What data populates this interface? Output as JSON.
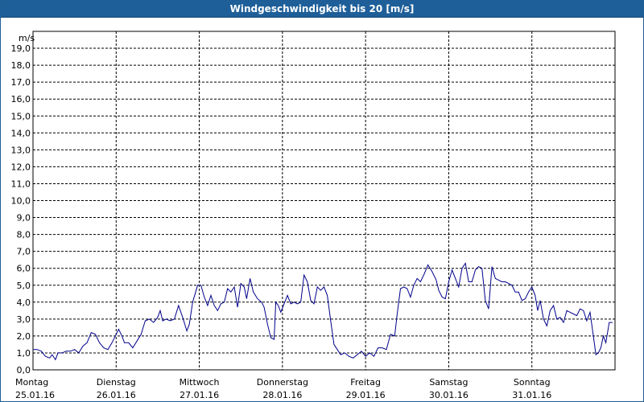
{
  "window": {
    "title": "Windgeschwindigkeit bis 20 [m/s]"
  },
  "chart_data": {
    "type": "line",
    "title": "Windgeschwindigkeit bis 20 [m/s]",
    "ylabel": "m/s",
    "xlabel": "",
    "ylim": [
      0,
      20
    ],
    "xlim": [
      0,
      7
    ],
    "y_ticks": [
      "0,0",
      "1,0",
      "2,0",
      "3,0",
      "4,0",
      "5,0",
      "6,0",
      "7,0",
      "8,0",
      "9,0",
      "10,0",
      "11,0",
      "12,0",
      "13,0",
      "14,0",
      "15,0",
      "16,0",
      "17,0",
      "18,0",
      "19,0"
    ],
    "x_ticks": [
      {
        "day": "Montag",
        "date": "25.01.16"
      },
      {
        "day": "Dienstag",
        "date": "26.01.16"
      },
      {
        "day": "Mittwoch",
        "date": "27.01.16"
      },
      {
        "day": "Donnerstag",
        "date": "28.01.16"
      },
      {
        "day": "Freitag",
        "date": "29.01.16"
      },
      {
        "day": "Samstag",
        "date": "30.01.16"
      },
      {
        "day": "Sonntag",
        "date": "31.01.16"
      }
    ],
    "grid": true,
    "line_color": "#00008b",
    "series": [
      {
        "values": [
          [
            0.0,
            1.2
          ],
          [
            0.05,
            1.2
          ],
          [
            0.1,
            1.1
          ],
          [
            0.15,
            0.8
          ],
          [
            0.2,
            0.7
          ],
          [
            0.23,
            0.9
          ],
          [
            0.27,
            0.6
          ],
          [
            0.3,
            1.0
          ],
          [
            0.35,
            1.0
          ],
          [
            0.4,
            1.1
          ],
          [
            0.45,
            1.1
          ],
          [
            0.5,
            1.2
          ],
          [
            0.55,
            1.0
          ],
          [
            0.6,
            1.4
          ],
          [
            0.65,
            1.6
          ],
          [
            0.7,
            2.2
          ],
          [
            0.75,
            2.1
          ],
          [
            0.8,
            1.6
          ],
          [
            0.85,
            1.3
          ],
          [
            0.9,
            1.2
          ],
          [
            0.95,
            1.6
          ],
          [
            1.0,
            2.1
          ],
          [
            1.03,
            2.4
          ],
          [
            1.07,
            2.0
          ],
          [
            1.1,
            1.6
          ],
          [
            1.15,
            1.6
          ],
          [
            1.2,
            1.3
          ],
          [
            1.25,
            1.7
          ],
          [
            1.3,
            2.1
          ],
          [
            1.35,
            2.9
          ],
          [
            1.4,
            3.0
          ],
          [
            1.45,
            2.8
          ],
          [
            1.5,
            3.1
          ],
          [
            1.53,
            3.5
          ],
          [
            1.56,
            2.9
          ],
          [
            1.6,
            3.0
          ],
          [
            1.65,
            2.9
          ],
          [
            1.7,
            3.0
          ],
          [
            1.75,
            3.8
          ],
          [
            1.8,
            3.1
          ],
          [
            1.85,
            2.3
          ],
          [
            1.88,
            2.7
          ],
          [
            1.92,
            4.0
          ],
          [
            1.95,
            4.5
          ],
          [
            1.98,
            5.0
          ],
          [
            2.02,
            5.0
          ],
          [
            2.06,
            4.3
          ],
          [
            2.1,
            3.8
          ],
          [
            2.14,
            4.4
          ],
          [
            2.18,
            3.8
          ],
          [
            2.22,
            3.5
          ],
          [
            2.26,
            3.9
          ],
          [
            2.3,
            4.0
          ],
          [
            2.34,
            4.8
          ],
          [
            2.38,
            4.6
          ],
          [
            2.42,
            4.9
          ],
          [
            2.46,
            3.7
          ],
          [
            2.5,
            5.1
          ],
          [
            2.54,
            4.9
          ],
          [
            2.57,
            4.2
          ],
          [
            2.61,
            5.4
          ],
          [
            2.65,
            4.6
          ],
          [
            2.7,
            4.2
          ],
          [
            2.75,
            4.0
          ],
          [
            2.78,
            3.7
          ],
          [
            2.82,
            2.7
          ],
          [
            2.86,
            1.9
          ],
          [
            2.9,
            1.8
          ],
          [
            2.92,
            4.0
          ],
          [
            2.95,
            3.8
          ],
          [
            2.98,
            3.4
          ],
          [
            3.02,
            3.9
          ],
          [
            3.06,
            4.4
          ],
          [
            3.1,
            3.9
          ],
          [
            3.14,
            4.0
          ],
          [
            3.18,
            3.9
          ],
          [
            3.22,
            4.0
          ],
          [
            3.26,
            5.6
          ],
          [
            3.3,
            5.2
          ],
          [
            3.34,
            4.1
          ],
          [
            3.38,
            3.9
          ],
          [
            3.42,
            4.9
          ],
          [
            3.46,
            4.7
          ],
          [
            3.5,
            4.9
          ],
          [
            3.54,
            4.4
          ],
          [
            3.58,
            2.9
          ],
          [
            3.62,
            1.5
          ],
          [
            3.66,
            1.2
          ],
          [
            3.7,
            0.9
          ],
          [
            3.75,
            1.0
          ],
          [
            3.8,
            0.8
          ],
          [
            3.85,
            0.7
          ],
          [
            3.9,
            0.9
          ],
          [
            3.95,
            1.1
          ],
          [
            4.0,
            0.8
          ],
          [
            4.05,
            1.0
          ],
          [
            4.1,
            0.8
          ],
          [
            4.15,
            1.3
          ],
          [
            4.2,
            1.3
          ],
          [
            4.25,
            1.2
          ],
          [
            4.3,
            2.1
          ],
          [
            4.35,
            2.0
          ],
          [
            4.38,
            3.3
          ],
          [
            4.42,
            4.8
          ],
          [
            4.46,
            4.9
          ],
          [
            4.5,
            4.8
          ],
          [
            4.54,
            4.3
          ],
          [
            4.58,
            5.0
          ],
          [
            4.62,
            5.4
          ],
          [
            4.66,
            5.2
          ],
          [
            4.7,
            5.6
          ],
          [
            4.75,
            6.2
          ],
          [
            4.8,
            5.8
          ],
          [
            4.85,
            5.3
          ],
          [
            4.88,
            4.7
          ],
          [
            4.92,
            4.3
          ],
          [
            4.96,
            4.2
          ],
          [
            5.0,
            5.2
          ],
          [
            5.04,
            5.9
          ],
          [
            5.08,
            5.4
          ],
          [
            5.12,
            4.9
          ],
          [
            5.16,
            6.0
          ],
          [
            5.2,
            6.3
          ],
          [
            5.24,
            5.2
          ],
          [
            5.28,
            5.2
          ],
          [
            5.32,
            5.9
          ],
          [
            5.36,
            6.1
          ],
          [
            5.4,
            6.0
          ],
          [
            5.44,
            4.1
          ],
          [
            5.48,
            3.6
          ],
          [
            5.52,
            6.1
          ],
          [
            5.56,
            5.4
          ],
          [
            5.6,
            5.3
          ],
          [
            5.64,
            5.2
          ],
          [
            5.68,
            5.2
          ],
          [
            5.72,
            5.1
          ],
          [
            5.76,
            5.0
          ],
          [
            5.8,
            4.6
          ],
          [
            5.84,
            4.6
          ],
          [
            5.88,
            4.1
          ],
          [
            5.92,
            4.2
          ],
          [
            5.96,
            4.6
          ],
          [
            6.0,
            4.9
          ],
          [
            6.04,
            4.4
          ],
          [
            6.07,
            3.5
          ],
          [
            6.1,
            4.1
          ],
          [
            6.14,
            3.0
          ],
          [
            6.18,
            2.6
          ],
          [
            6.22,
            3.5
          ],
          [
            6.26,
            3.8
          ],
          [
            6.3,
            3.0
          ],
          [
            6.34,
            3.1
          ],
          [
            6.38,
            2.8
          ],
          [
            6.42,
            3.5
          ],
          [
            6.46,
            3.4
          ],
          [
            6.5,
            3.3
          ],
          [
            6.54,
            3.2
          ],
          [
            6.58,
            3.6
          ],
          [
            6.62,
            3.5
          ],
          [
            6.66,
            2.9
          ],
          [
            6.7,
            3.4
          ],
          [
            6.74,
            2.0
          ],
          [
            6.77,
            0.9
          ],
          [
            6.8,
            1.0
          ],
          [
            6.83,
            1.3
          ],
          [
            6.86,
            2.0
          ],
          [
            6.89,
            1.6
          ],
          [
            6.93,
            2.8
          ],
          [
            6.97,
            2.8
          ]
        ]
      }
    ]
  }
}
